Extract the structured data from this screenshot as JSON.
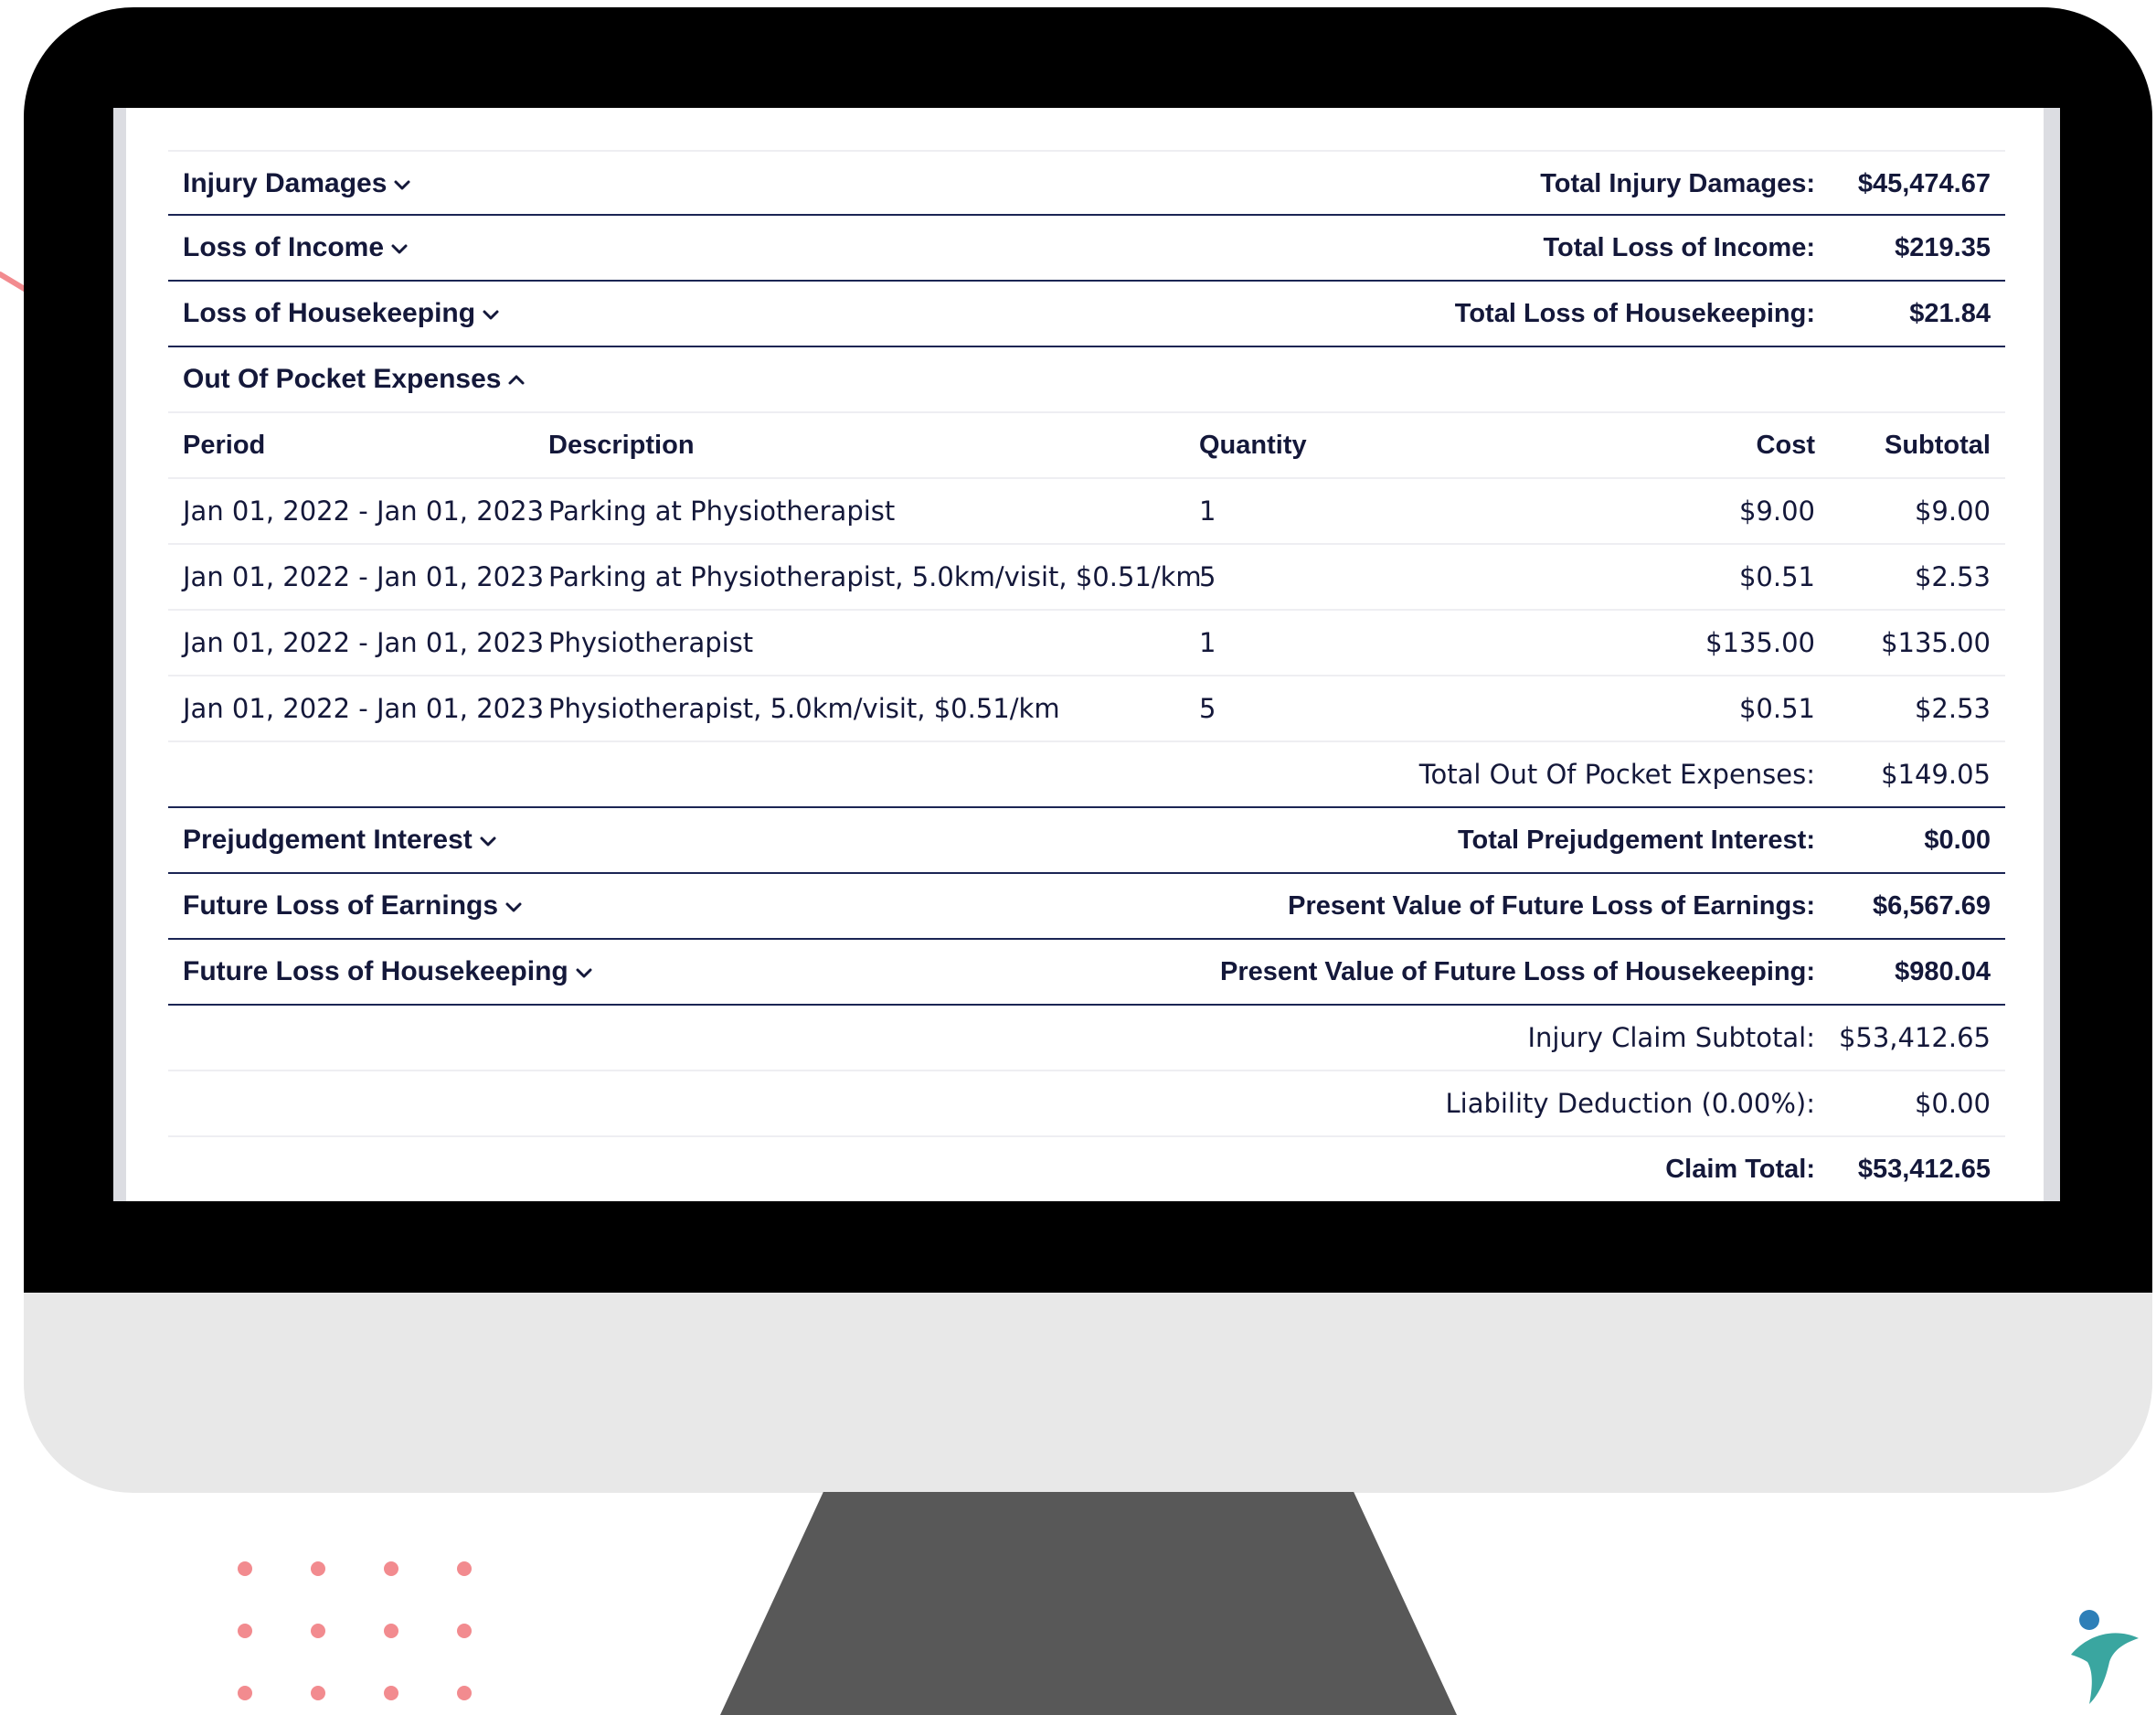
{
  "sections": {
    "injury_damages": {
      "title": "Injury Damages",
      "total_label": "Total Injury Damages:",
      "total_value": "$45,474.67"
    },
    "loss_of_income": {
      "title": "Loss of Income",
      "total_label": "Total Loss of Income:",
      "total_value": "$219.35"
    },
    "loss_of_housekeeping": {
      "title": "Loss of Housekeeping",
      "total_label": "Total Loss of Housekeeping:",
      "total_value": "$21.84"
    },
    "out_of_pocket": {
      "title": "Out Of Pocket Expenses",
      "expanded": true,
      "columns": {
        "period": "Period",
        "description": "Description",
        "quantity": "Quantity",
        "cost": "Cost",
        "subtotal": "Subtotal"
      },
      "rows": [
        {
          "period": "Jan 01, 2022 - Jan 01, 2023",
          "description": "Parking at Physiotherapist",
          "quantity": "1",
          "cost": "$9.00",
          "subtotal": "$9.00"
        },
        {
          "period": "Jan 01, 2022 - Jan 01, 2023",
          "description": "Parking at Physiotherapist, 5.0km/visit, $0.51/km",
          "quantity": "5",
          "cost": "$0.51",
          "subtotal": "$2.53"
        },
        {
          "period": "Jan 01, 2022 - Jan 01, 2023",
          "description": "Physiotherapist",
          "quantity": "1",
          "cost": "$135.00",
          "subtotal": "$135.00"
        },
        {
          "period": "Jan 01, 2022 - Jan 01, 2023",
          "description": "Physiotherapist, 5.0km/visit, $0.51/km",
          "quantity": "5",
          "cost": "$0.51",
          "subtotal": "$2.53"
        }
      ],
      "total_label": "Total Out Of Pocket Expenses:",
      "total_value": "$149.05"
    },
    "prejudgement_interest": {
      "title": "Prejudgement Interest",
      "total_label": "Total Prejudgement Interest:",
      "total_value": "$0.00"
    },
    "future_loss_of_earnings": {
      "title": "Future Loss of Earnings",
      "total_label": "Present Value of Future Loss of Earnings:",
      "total_value": "$6,567.69"
    },
    "future_loss_of_housekeeping": {
      "title": "Future Loss of Housekeeping",
      "total_label": "Present Value of Future Loss of Housekeeping:",
      "total_value": "$980.04"
    }
  },
  "summary": {
    "subtotal_label": "Injury Claim Subtotal:",
    "subtotal_value": "$53,412.65",
    "liability_label": "Liability Deduction (0.00%):",
    "liability_value": "$0.00",
    "claim_total_label": "Claim Total:",
    "claim_total_value": "$53,412.65"
  },
  "colors": {
    "text": "#14183a",
    "section_rule": "#1b2554",
    "row_rule": "#eeeef2",
    "bezel": "#000000",
    "monitor_body": "#e8e8e8",
    "stand": "#585858",
    "accent_pink": "#f28b8f",
    "logo_teal": "#3aa6a0"
  },
  "icons": {
    "collapsed": "chevron-down-icon",
    "expanded": "chevron-up-icon"
  }
}
